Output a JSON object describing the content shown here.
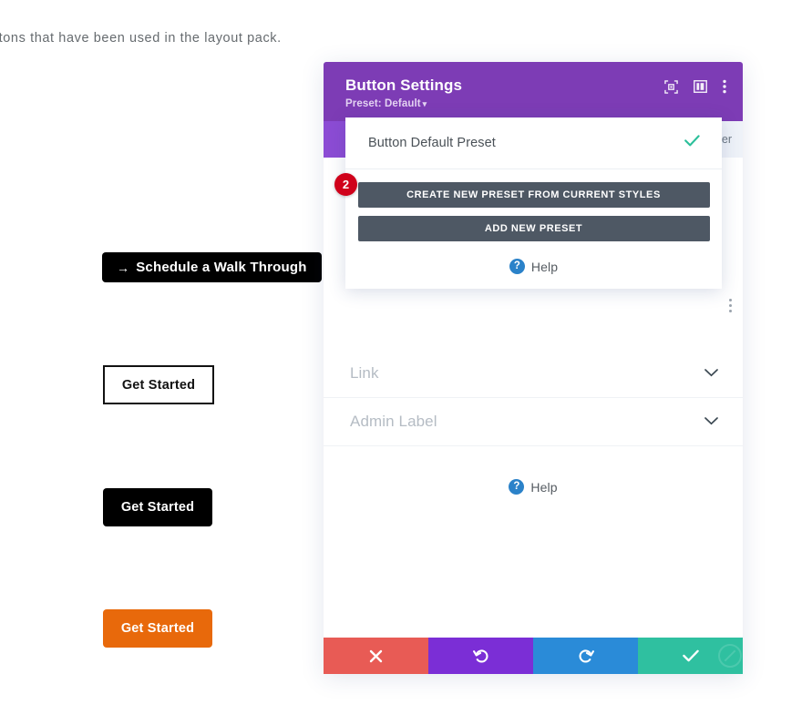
{
  "page": {
    "intro_text": "ttons that have been used in the layout pack."
  },
  "demo_buttons": [
    {
      "name": "schedule-walk-through",
      "arrow": "→",
      "label": "Schedule a Walk Through",
      "style": "filled-black"
    },
    {
      "name": "get-started-outline",
      "label": "Get Started",
      "style": "outline-black"
    },
    {
      "name": "get-started-black",
      "label": "Get Started",
      "style": "filled-black"
    },
    {
      "name": "get-started-orange",
      "label": "Get Started",
      "style": "filled-orange",
      "color": "#e8690b"
    }
  ],
  "modal": {
    "title": "Button Settings",
    "preset_label": "Preset: Default",
    "preset_caret": "▾",
    "header_icons": [
      {
        "name": "focus-target-icon"
      },
      {
        "name": "panel-layout-icon"
      },
      {
        "name": "more-options-icon"
      }
    ],
    "tab_partial_label": "er",
    "accordions": [
      {
        "name": "link",
        "label": "Link"
      },
      {
        "name": "admin-label",
        "label": "Admin Label"
      }
    ],
    "help": {
      "badge": "?",
      "label": "Help"
    },
    "footer_buttons": [
      {
        "name": "cancel-button",
        "icon": "close-icon",
        "color": "#e85b55"
      },
      {
        "name": "undo-button",
        "icon": "undo-icon",
        "color": "#7b2ed6"
      },
      {
        "name": "redo-button",
        "icon": "redo-icon",
        "color": "#2a8bd8"
      },
      {
        "name": "save-button",
        "icon": "check-icon",
        "color": "#2fc0a0"
      }
    ],
    "colors": {
      "header": "#7d3cb5",
      "tabbar": "#8c4cd4",
      "accent": "#7d3cb5"
    }
  },
  "preset_dropdown": {
    "items": [
      {
        "name": "Button Default Preset",
        "selected": true
      }
    ],
    "actions": [
      {
        "name": "create-new-preset-from-current-styles",
        "label": "CREATE NEW PRESET FROM CURRENT STYLES"
      },
      {
        "name": "add-new-preset",
        "label": "ADD NEW PRESET"
      }
    ],
    "help": {
      "badge": "?",
      "label": "Help"
    }
  },
  "annotation": {
    "badge_number": "2",
    "badge_color": "#d0021b"
  }
}
